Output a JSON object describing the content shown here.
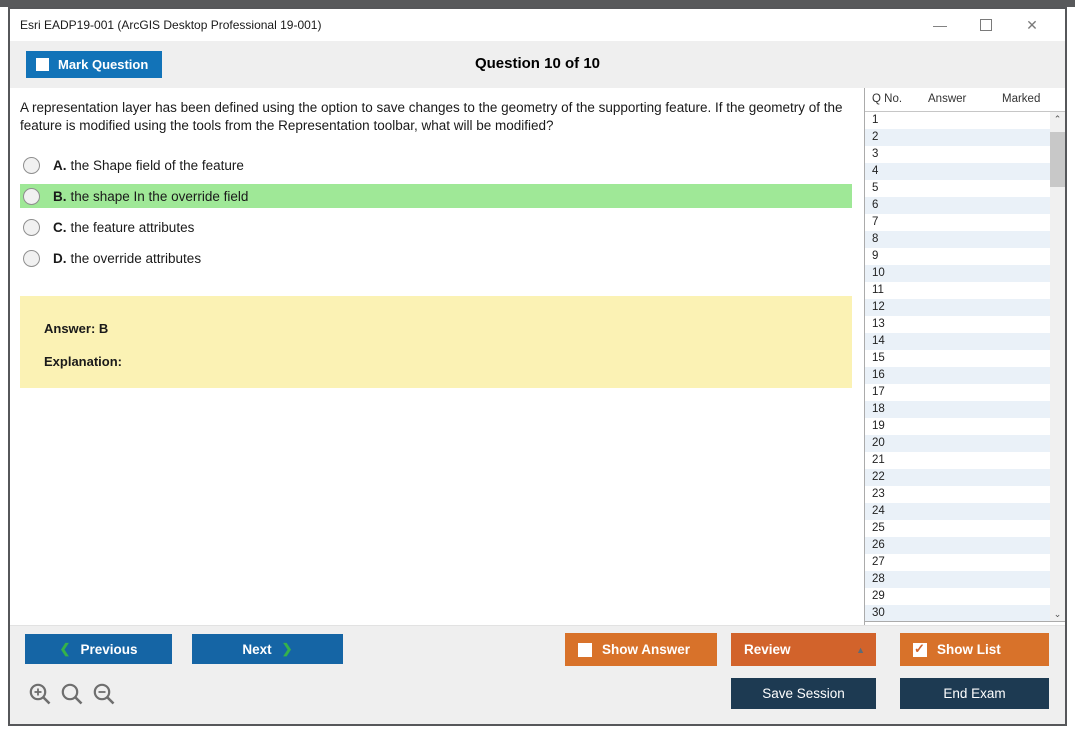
{
  "window": {
    "title": "Esri EADP19-001 (ArcGIS Desktop Professional 19-001)"
  },
  "titlebar_icons": {
    "minimize": "—",
    "close": "✕"
  },
  "toolbar": {
    "mark_question": "Mark Question",
    "question_counter": "Question 10 of 10"
  },
  "question": {
    "text": "A representation layer has been defined using the option to save changes to the geometry of the supporting feature. If the geometry of the feature is modified using the tools from the Representation toolbar, what will be modified?",
    "options": [
      {
        "letter": "A.",
        "text": "the Shape field of the feature",
        "highlighted": false
      },
      {
        "letter": "B.",
        "text": "the shape In the override field",
        "highlighted": true
      },
      {
        "letter": "C.",
        "text": "the feature attributes",
        "highlighted": false
      },
      {
        "letter": "D.",
        "text": "the override attributes",
        "highlighted": false
      }
    ]
  },
  "answer_panel": {
    "answer": "Answer: B",
    "explanation": "Explanation:"
  },
  "question_list": {
    "headers": [
      "Q No.",
      "Answer",
      "Marked"
    ],
    "rows": [
      [
        "1",
        "",
        ""
      ],
      [
        "2",
        "",
        ""
      ],
      [
        "3",
        "",
        ""
      ],
      [
        "4",
        "",
        ""
      ],
      [
        "5",
        "",
        ""
      ],
      [
        "6",
        "",
        ""
      ],
      [
        "7",
        "",
        ""
      ],
      [
        "8",
        "",
        ""
      ],
      [
        "9",
        "",
        ""
      ],
      [
        "10",
        "",
        ""
      ],
      [
        "11",
        "",
        ""
      ],
      [
        "12",
        "",
        ""
      ],
      [
        "13",
        "",
        ""
      ],
      [
        "14",
        "",
        ""
      ],
      [
        "15",
        "",
        ""
      ],
      [
        "16",
        "",
        ""
      ],
      [
        "17",
        "",
        ""
      ],
      [
        "18",
        "",
        ""
      ],
      [
        "19",
        "",
        ""
      ],
      [
        "20",
        "",
        ""
      ],
      [
        "21",
        "",
        ""
      ],
      [
        "22",
        "",
        ""
      ],
      [
        "23",
        "",
        ""
      ],
      [
        "24",
        "",
        ""
      ],
      [
        "25",
        "",
        ""
      ],
      [
        "26",
        "",
        ""
      ],
      [
        "27",
        "",
        ""
      ],
      [
        "28",
        "",
        ""
      ],
      [
        "29",
        "",
        ""
      ],
      [
        "30",
        "",
        ""
      ]
    ]
  },
  "footer": {
    "previous": "Previous",
    "next": "Next",
    "show_answer": "Show Answer",
    "review": "Review",
    "show_list": "Show List",
    "save_session": "Save Session",
    "end_exam": "End Exam"
  },
  "icons": {
    "chevron_left": "❮",
    "chevron_right": "❯",
    "triangle_up": "▲",
    "check": "✓",
    "scroll_up": "⌃",
    "scroll_down": "⌄",
    "zoom_in": "magnifier-plus",
    "zoom_reset": "magnifier",
    "zoom_out": "magnifier-minus"
  },
  "colors": {
    "accent_blue": "#1273B8",
    "nav_blue": "#1565A5",
    "orange": "#D8722A",
    "review_orange": "#D2632B",
    "navy": "#1D3A52",
    "highlight_green": "#9FE897",
    "answer_yellow": "#FBF2B4",
    "row_alt_blue": "#EAF1F8",
    "chevron_green": "#35B24A"
  }
}
